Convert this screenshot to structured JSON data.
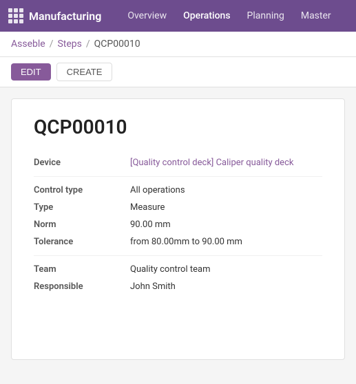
{
  "nav": {
    "logo": "Manufacturing",
    "links": [
      {
        "label": "Overview",
        "active": false
      },
      {
        "label": "Operations",
        "active": true
      },
      {
        "label": "Planning",
        "active": false
      },
      {
        "label": "Master",
        "active": false
      }
    ]
  },
  "breadcrumb": {
    "parent1": "Asseble",
    "parent2": "Steps",
    "current": "QCP00010"
  },
  "actions": {
    "edit_label": "EDIT",
    "create_label": "CREATE"
  },
  "record": {
    "title": "QCP00010",
    "fields": {
      "device_label": "Device",
      "device_value": "[Quality control deck] Caliper quality deck",
      "control_type_label": "Control type",
      "control_type_value": "All operations",
      "type_label": "Type",
      "type_value": "Measure",
      "norm_label": "Norm",
      "norm_value": "90.00 mm",
      "tolerance_label": "Tolerance",
      "tolerance_value": "from 80.00mm to 90.00 mm",
      "team_label": "Team",
      "team_value": "Quality control team",
      "responsible_label": "Responsible",
      "responsible_value": "John Smith"
    }
  }
}
